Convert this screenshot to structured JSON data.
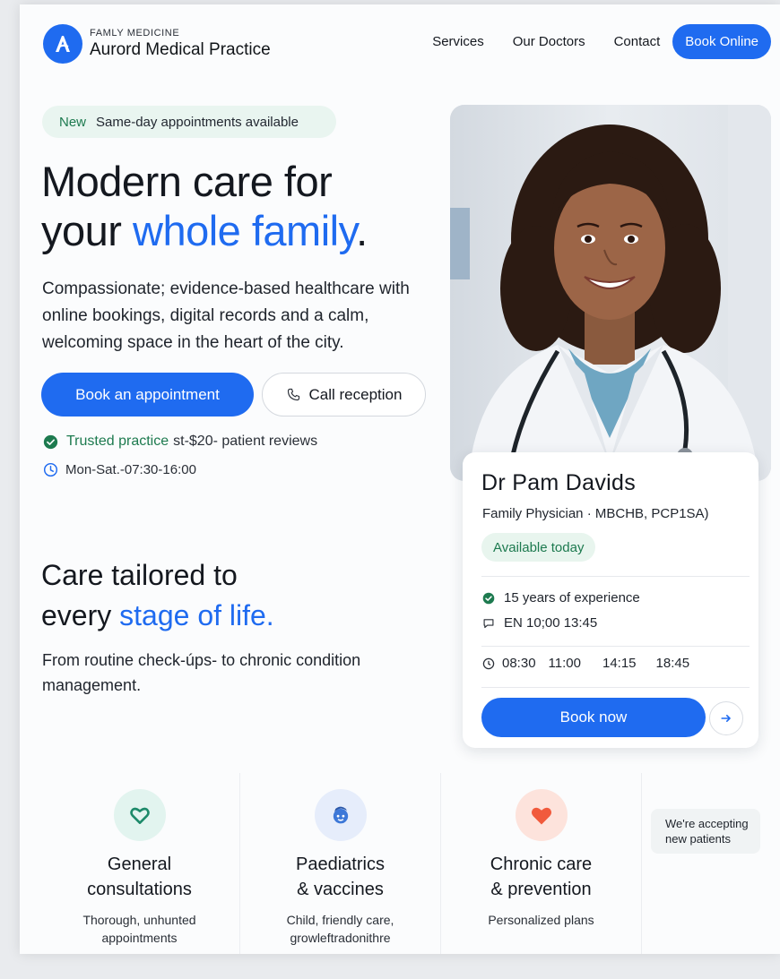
{
  "header": {
    "brand_kicker": "FAMLY MEDICINE",
    "brand_name": "Aurord Medical Practice",
    "nav": [
      "Services",
      "Our Doctors",
      "Contact"
    ],
    "cta": "Book Online"
  },
  "hero": {
    "badge_tag": "New",
    "badge_text": "Same-day appointments available",
    "title_line1": "Modern care for",
    "title_line2_pre": "your ",
    "title_line2_accent": "whole family",
    "title_line2_post": ".",
    "description": "Compassionate; evidence-based healthcare with online bookings, digital records and a calm, welcoming space in the heart of the city.",
    "primary_button": "Book an appointment",
    "secondary_button": "Call reception",
    "trust_pre": "",
    "trust_green": "Trusted practice",
    "trust_post": "st-$20- patient reviews",
    "hours": "Mon-Sat.-07:30-16:00"
  },
  "section": {
    "title_line1": "Care tailored to",
    "title_line2_pre": "every ",
    "title_line2_accent": "stage of life.",
    "description": "From routine check-úps- to chronic condition management."
  },
  "doctor": {
    "name": "Dr Pam Davids",
    "role": "Family Physician · MBCHB, PCP1SA)",
    "availability": "Available today",
    "experience": "15 years of experience",
    "languages": "EN  10;00 13:45",
    "slots": [
      "08:30",
      "11:00",
      "14:15",
      "18:45"
    ],
    "book_button": "Book now"
  },
  "services": [
    {
      "title_line1": "General",
      "title_line2": "consultations",
      "desc_line1": "Thorough, unhunted",
      "desc_line2": "appointments",
      "icon": "heart-outline-icon"
    },
    {
      "title_line1": "Paediatrics",
      "title_line2": "& vaccines",
      "desc_line1": "Child, friendly care,",
      "desc_line2": "growleftradonithre",
      "icon": "child-icon"
    },
    {
      "title_line1": "Chronic care",
      "title_line2": "& prevention",
      "desc_line1": "Personalized plans",
      "desc_line2": "",
      "icon": "heart-icon"
    }
  ],
  "accepting": {
    "line1": "We're accepting",
    "line2": "new patients"
  },
  "colors": {
    "primary": "#1f6bf0",
    "green": "#1d7a4f",
    "coral": "#f15a3c"
  }
}
